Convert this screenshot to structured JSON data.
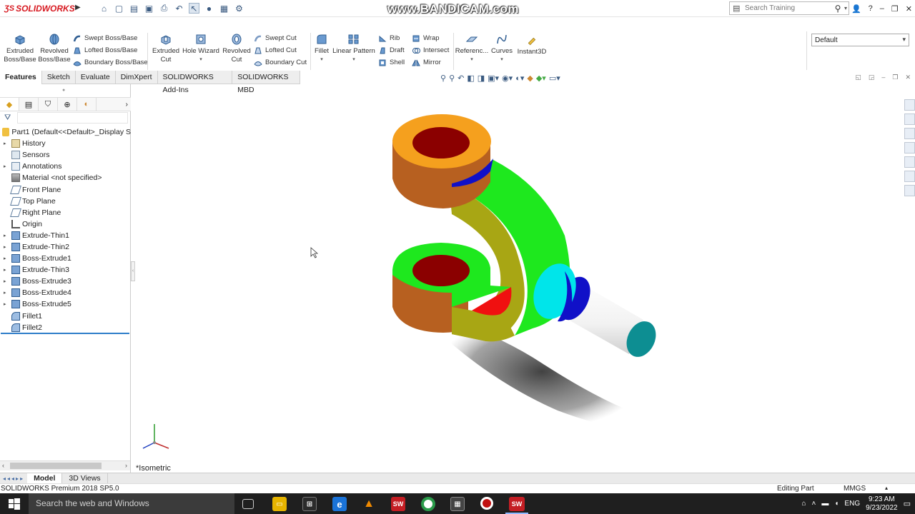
{
  "app": {
    "logo_text": "SOLIDWORKS",
    "watermark": "www.BANDICAM.com",
    "search_placeholder": "Search Training"
  },
  "ribbon": {
    "buttons": [
      {
        "label_line1": "Extruded",
        "label_line2": "Boss/Base"
      },
      {
        "label_line1": "Revolved",
        "label_line2": "Boss/Base"
      }
    ],
    "boss_rows": [
      "Swept Boss/Base",
      "Lofted Boss/Base",
      "Boundary Boss/Base"
    ],
    "cut_buttons": [
      {
        "label_line1": "Extruded",
        "label_line2": "Cut"
      },
      {
        "label_line1": "Hole Wizard",
        "label_line2": ""
      },
      {
        "label_line1": "Revolved",
        "label_line2": "Cut"
      }
    ],
    "cut_rows": [
      "Swept Cut",
      "Lofted Cut",
      "Boundary Cut"
    ],
    "fillet": "Fillet",
    "linear_pattern": "Linear Pattern",
    "feature_rows_a": [
      "Rib",
      "Draft",
      "Shell"
    ],
    "feature_rows_b": [
      "Wrap",
      "Intersect",
      "Mirror"
    ],
    "reference": "Referenc...",
    "curves": "Curves",
    "instant3d": "Instant3D",
    "config_dropdown": "Default"
  },
  "tabs": [
    "Features",
    "Sketch",
    "Evaluate",
    "DimXpert",
    "SOLIDWORKS Add-Ins",
    "SOLIDWORKS MBD"
  ],
  "active_tab": "Features",
  "tree": {
    "root": "Part1  (Default<<Default>_Display S",
    "items": [
      {
        "label": "History",
        "icon": "folder-icon",
        "expandable": true
      },
      {
        "label": "Sensors",
        "icon": "sensor-icon",
        "expandable": false
      },
      {
        "label": "Annotations",
        "icon": "annotation-icon",
        "expandable": true
      },
      {
        "label": "Material <not specified>",
        "icon": "material-icon",
        "expandable": false
      },
      {
        "label": "Front Plane",
        "icon": "plane-icon",
        "expandable": false
      },
      {
        "label": "Top Plane",
        "icon": "plane-icon",
        "expandable": false
      },
      {
        "label": "Right Plane",
        "icon": "plane-icon",
        "expandable": false
      },
      {
        "label": "Origin",
        "icon": "origin-icon",
        "expandable": false
      },
      {
        "label": "Extrude-Thin1",
        "icon": "extrude-icon",
        "expandable": true
      },
      {
        "label": "Extrude-Thin2",
        "icon": "extrude-icon",
        "expandable": true
      },
      {
        "label": "Boss-Extrude1",
        "icon": "extrude-icon",
        "expandable": true
      },
      {
        "label": "Extrude-Thin3",
        "icon": "extrude-icon",
        "expandable": true
      },
      {
        "label": "Boss-Extrude3",
        "icon": "extrude-icon",
        "expandable": true
      },
      {
        "label": "Boss-Extrude4",
        "icon": "extrude-icon",
        "expandable": true
      },
      {
        "label": "Boss-Extrude5",
        "icon": "extrude-icon",
        "expandable": true
      },
      {
        "label": "Fillet1",
        "icon": "fillet-icon",
        "expandable": false
      },
      {
        "label": "Fillet2",
        "icon": "fillet-icon",
        "expandable": false
      }
    ]
  },
  "viewport": {
    "view_label": "*Isometric",
    "colors": {
      "orange_top": "#f5a01e",
      "hole": "#8b0000",
      "side_brown": "#b76020",
      "green": "#1ee81e",
      "olive": "#a8a614",
      "blue_ring": "#1010c8",
      "cyan": "#00e5ea",
      "shaft_end": "#0d8e92",
      "red_face": "#f01010"
    }
  },
  "bottom_tabs": [
    "Model",
    "3D Views"
  ],
  "active_bottom_tab": "Model",
  "status": {
    "version": "SOLIDWORKS Premium 2018 SP5.0",
    "mode": "Editing Part",
    "units": "MMGS"
  },
  "taskbar": {
    "search": "Search the web and Windows",
    "language": "ENG",
    "time": "9:23 AM",
    "date": "9/23/2022"
  }
}
